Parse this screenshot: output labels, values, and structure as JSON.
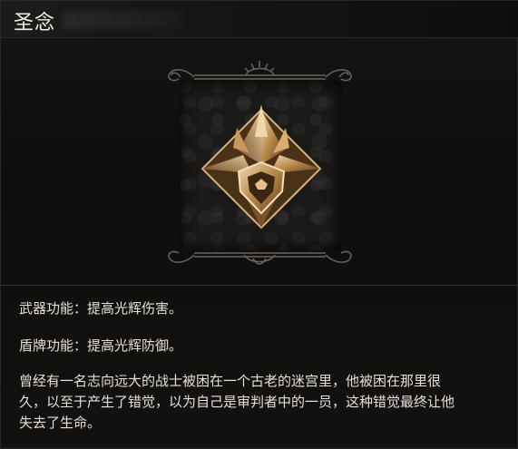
{
  "item": {
    "title": "圣念",
    "title_suffix_redacted": true,
    "icon": "holy-crystal-rune-icon"
  },
  "description": {
    "weapon_function": "武器功能：提高光辉伤害。",
    "shield_function": "盾牌功能：提高光辉防御。",
    "lore": "曾经有一名志向远大的战士被困在一个古老的迷宫里，他被困在那里很\n久，以至于产生了错觉，以为自己是审判者中的一员，这种错觉最终让他\n失去了生命。"
  },
  "colors": {
    "background": "#0c0b0b",
    "text": "#e6e0d6",
    "gold": "#b8874a",
    "frame": "#6b6560"
  }
}
